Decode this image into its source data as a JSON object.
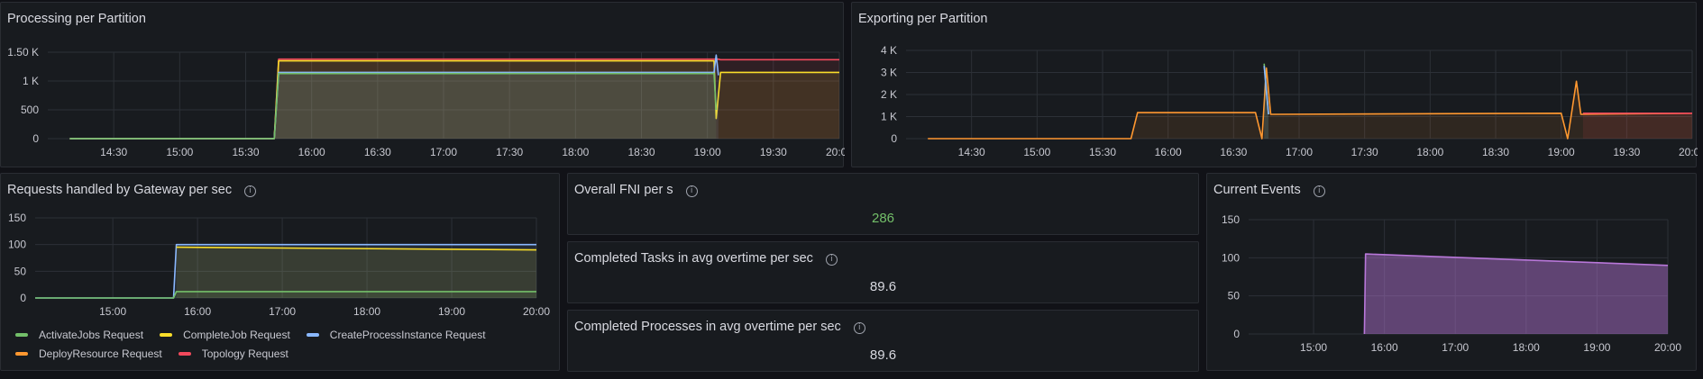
{
  "colors": {
    "green": "#73bf69",
    "yellow": "#fade2a",
    "blue": "#8ab8ff",
    "orange": "#ff9830",
    "red": "#f2495c",
    "purple": "#b877d9",
    "stat_green": "#73bf69"
  },
  "panels": {
    "processing": {
      "title": "Processing per Partition"
    },
    "exporting": {
      "title": "Exporting per Partition"
    },
    "gateway": {
      "title": "Requests handled by Gateway per sec",
      "legend": [
        {
          "label": "ActivateJobs Request",
          "color": "#73bf69"
        },
        {
          "label": "CompleteJob Request",
          "color": "#fade2a"
        },
        {
          "label": "CreateProcessInstance Request",
          "color": "#8ab8ff"
        },
        {
          "label": "DeployResource Request",
          "color": "#ff9830"
        },
        {
          "label": "Topology Request",
          "color": "#f2495c"
        }
      ]
    },
    "fni": {
      "title": "Overall FNI per s",
      "value": "286"
    },
    "tasks": {
      "title": "Completed Tasks in avg overtime per sec",
      "value": "89.6"
    },
    "processes": {
      "title": "Completed Processes in avg overtime per sec",
      "value": "89.6"
    },
    "events": {
      "title": "Current Events"
    }
  },
  "chart_data": [
    {
      "id": "processing",
      "type": "line",
      "x_ticks": [
        "14:30",
        "15:00",
        "15:30",
        "16:00",
        "16:30",
        "17:00",
        "17:30",
        "18:00",
        "18:30",
        "19:00",
        "19:30",
        "20:00"
      ],
      "y_ticks": [
        "0",
        "500",
        "1 K",
        "1.50 K"
      ],
      "ylim": [
        0,
        1500
      ],
      "xlim": [
        "14:00",
        "20:00"
      ],
      "series": [
        {
          "color": "#f2495c",
          "points": [
            [
              "14:10",
              0
            ],
            [
              "15:43",
              0
            ],
            [
              "15:45",
              1380
            ],
            [
              "19:05",
              1380
            ],
            [
              "19:06",
              1370
            ],
            [
              "20:00",
              1370
            ]
          ]
        },
        {
          "color": "#fade2a",
          "points": [
            [
              "14:10",
              0
            ],
            [
              "15:43",
              0
            ],
            [
              "15:45",
              1350
            ],
            [
              "19:03",
              1350
            ],
            [
              "19:04",
              350
            ],
            [
              "19:06",
              1150
            ],
            [
              "20:00",
              1150
            ]
          ]
        },
        {
          "color": "#8ab8ff",
          "points": [
            [
              "14:10",
              0
            ],
            [
              "15:43",
              0
            ],
            [
              "15:45",
              1150
            ],
            [
              "19:03",
              1150
            ],
            [
              "19:04",
              1450
            ],
            [
              "19:05",
              1100
            ]
          ]
        },
        {
          "color": "#73bf69",
          "points": [
            [
              "14:10",
              0
            ],
            [
              "15:43",
              0
            ],
            [
              "15:45",
              1130
            ],
            [
              "19:03",
              1130
            ],
            [
              "19:04",
              500
            ]
          ]
        }
      ]
    },
    {
      "id": "exporting",
      "type": "line",
      "x_ticks": [
        "14:30",
        "15:00",
        "15:30",
        "16:00",
        "16:30",
        "17:00",
        "17:30",
        "18:00",
        "18:30",
        "19:00",
        "19:30",
        "20:00"
      ],
      "y_ticks": [
        "0",
        "1 K",
        "2 K",
        "3 K",
        "4 K"
      ],
      "ylim": [
        0,
        4000
      ],
      "xlim": [
        "14:00",
        "20:00"
      ],
      "series": [
        {
          "color": "#ff9830",
          "points": [
            [
              "14:10",
              0
            ],
            [
              "15:43",
              0
            ],
            [
              "15:46",
              1180
            ],
            [
              "16:40",
              1180
            ],
            [
              "16:43",
              0
            ],
            [
              "16:45",
              3200
            ],
            [
              "16:47",
              1100
            ],
            [
              "19:00",
              1150
            ],
            [
              "19:03",
              0
            ],
            [
              "19:07",
              2600
            ],
            [
              "19:09",
              1100
            ],
            [
              "20:00",
              1150
            ]
          ]
        },
        {
          "color": "#f2495c",
          "points": [
            [
              "19:10",
              1150
            ],
            [
              "20:00",
              1150
            ]
          ]
        },
        {
          "color": "#73bf69",
          "points": [
            [
              "16:44",
              3400
            ],
            [
              "16:46",
              1100
            ]
          ]
        },
        {
          "color": "#8ab8ff",
          "points": [
            [
              "16:44",
              3300
            ],
            [
              "16:46",
              1100
            ]
          ]
        }
      ]
    },
    {
      "id": "gateway",
      "type": "line",
      "x_ticks": [
        "15:00",
        "16:00",
        "17:00",
        "18:00",
        "19:00",
        "20:00"
      ],
      "y_ticks": [
        "0",
        "50",
        "100",
        "150"
      ],
      "ylim": [
        0,
        150
      ],
      "xlim": [
        "14:05",
        "20:00"
      ],
      "series": [
        {
          "name": "CreateProcessInstance Request",
          "color": "#8ab8ff",
          "points": [
            [
              "14:05",
              0
            ],
            [
              "15:43",
              0
            ],
            [
              "15:45",
              100
            ],
            [
              "20:00",
              100
            ]
          ]
        },
        {
          "name": "CompleteJob Request",
          "color": "#fade2a",
          "points": [
            [
              "15:45",
              95
            ],
            [
              "20:00",
              90
            ]
          ]
        },
        {
          "name": "ActivateJobs Request",
          "color": "#73bf69",
          "points": [
            [
              "14:05",
              0
            ],
            [
              "15:43",
              0
            ],
            [
              "15:45",
              12
            ],
            [
              "20:00",
              12
            ]
          ]
        }
      ]
    },
    {
      "id": "events",
      "type": "area",
      "x_ticks": [
        "15:00",
        "16:00",
        "17:00",
        "18:00",
        "19:00",
        "20:00"
      ],
      "y_ticks": [
        "0",
        "50",
        "100",
        "150"
      ],
      "ylim": [
        0,
        150
      ],
      "xlim": [
        "14:05",
        "20:00"
      ],
      "series": [
        {
          "color": "#b877d9",
          "points": [
            [
              "15:43",
              0
            ],
            [
              "15:44",
              105
            ],
            [
              "20:00",
              90
            ]
          ]
        }
      ]
    }
  ]
}
